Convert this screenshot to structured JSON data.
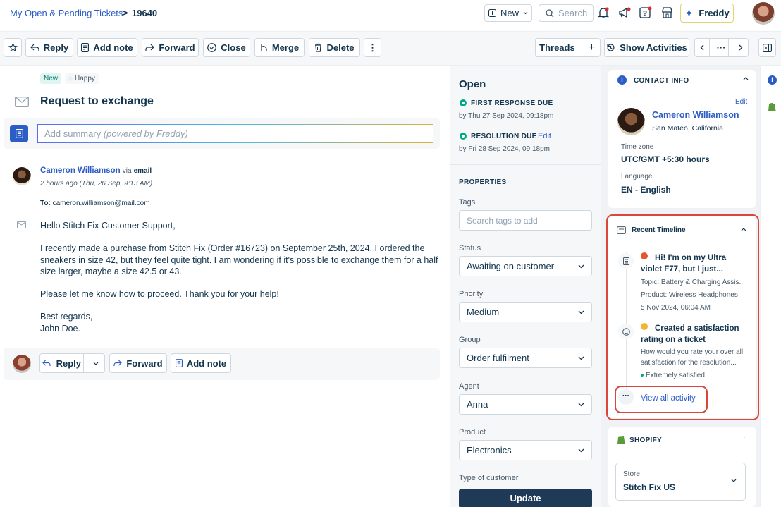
{
  "header": {
    "breadcrumb_link": "My Open & Pending Tickets",
    "breadcrumb_sep": ">",
    "ticket_id": "19640",
    "new_label": "New",
    "search_placeholder": "Search",
    "freddy_label": "Freddy"
  },
  "toolbar": {
    "reply": "Reply",
    "add_note": "Add note",
    "forward": "Forward",
    "close": "Close",
    "merge": "Merge",
    "delete": "Delete",
    "more": "⋮",
    "threads": "Threads",
    "plus": "+",
    "show_activities": "Show Activities",
    "nav_more": "···"
  },
  "ticket": {
    "badge_new": "New",
    "badge_sentiment": "Happy",
    "subject": "Request to exchange",
    "summary_placeholder": "Add summary",
    "summary_hint": "(powered by Freddy)"
  },
  "message": {
    "sender": "Cameron Williamson",
    "via": "via",
    "via_channel": "email",
    "time": "2 hours ago (Thu, 26 Sep, 9:13 AM)",
    "to_label": "To:",
    "to_address": "cameron.williamson@mail.com",
    "greeting": "Hello Stitch Fix Customer Support,",
    "para1_line1": "I recently made a purchase from Stitch Fix (Order #16723) on September 25th, 2024. I ordered the",
    "para1_line2": "sneakers in size 42, but they feel quite tight. I am wondering if it's possible to exchange them for a half",
    "para1_line3": "size larger, maybe a size 42.5 or 43.",
    "para2": "Please let me know how to proceed. Thank you for your help!",
    "closing": "Best regards,",
    "signature": "John Doe."
  },
  "reply_bar": {
    "reply": "Reply",
    "forward": "Forward",
    "add_note": "Add note"
  },
  "status_panel": {
    "status": "Open",
    "first_response_label": "FIRST RESPONSE DUE",
    "first_response_due": "by Thu 27 Sep 2024, 09:18pm",
    "resolution_label": "RESOLUTION DUE",
    "resolution_edit": "Edit",
    "resolution_due": "by Fri 28 Sep 2024, 09:18pm"
  },
  "properties": {
    "heading": "PROPERTIES",
    "tags_label": "Tags",
    "tags_placeholder": "Search tags to add",
    "status_label": "Status",
    "status_value": "Awaiting on customer",
    "priority_label": "Priority",
    "priority_value": "Medium",
    "group_label": "Group",
    "group_value": "Order fulfilment",
    "agent_label": "Agent",
    "agent_value": "Anna",
    "product_label": "Product",
    "product_value": "Electronics",
    "type_label": "Type of customer",
    "update_button": "Update"
  },
  "contact": {
    "heading": "CONTACT INFO",
    "edit": "Edit",
    "name": "Cameron Williamson",
    "location": "San Mateo, California",
    "timezone_label": "Time zone",
    "timezone_value": "UTC/GMT +5:30 hours",
    "language_label": "Language",
    "language_value": "EN - English"
  },
  "timeline": {
    "heading": "Recent Timeline",
    "item1_title_line1": "Hi! I'm on my Ultra",
    "item1_title_line2": "violet F77, but I just...",
    "item1_topic": "Topic: Battery & Charging Assis...",
    "item1_product": "Product: Wireless Headphones",
    "item1_date": "5 Nov 2024, 06:04 AM",
    "item2_title_line1": "Created a satisfaction",
    "item2_title_line2": "rating on a ticket",
    "item2_desc_line1": "How would you rate your over all",
    "item2_desc_line2": "satisfaction for the resolution...",
    "item2_rating": "Extremely satisfied",
    "view_all": "View all activity"
  },
  "shopify": {
    "heading": "SHOPIFY",
    "store_label": "Store",
    "store_value": "Stitch Fix US"
  },
  "colors": {
    "accent": "#2c5cc5",
    "highlight": "#d9473a",
    "green": "#00a886",
    "navy": "#1f3a56"
  }
}
